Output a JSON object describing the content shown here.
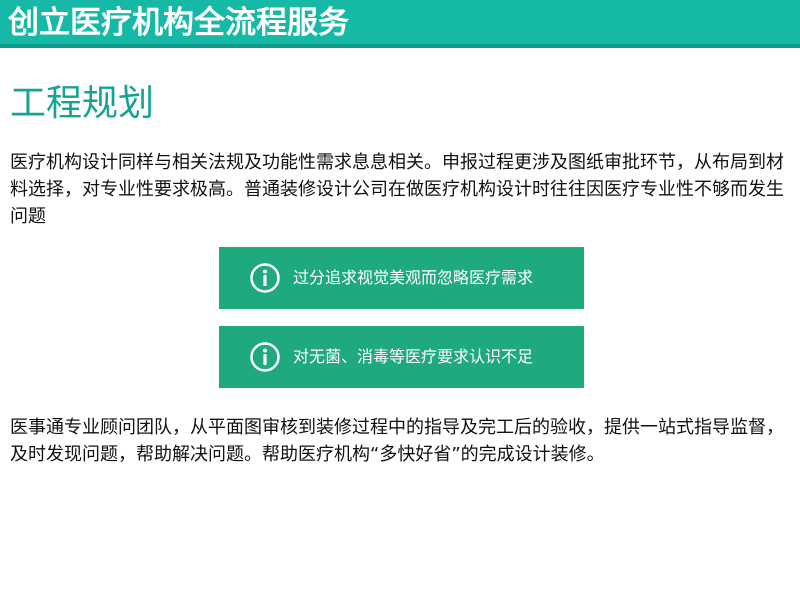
{
  "header": {
    "title": "创立医疗机构全流程服务"
  },
  "section": {
    "title": "工程规划"
  },
  "intro": {
    "text": "医疗机构设计同样与相关法规及功能性需求息息相关。申报过程更涉及图纸审批环节，从布局到材料选择，对专业性要求极高。普通装修设计公司在做医疗机构设计时往往因医疗专业性不够而发生问题"
  },
  "notices": [
    {
      "icon": "info-icon",
      "text": "过分追求视觉美观而忽略医疗需求"
    },
    {
      "icon": "info-icon",
      "text": "对无菌、消毒等医疗要求认识不足"
    }
  ],
  "summary": {
    "text": "医事通专业顾问团队，从平面图审核到装修过程中的指导及完工后的验收，提供一站式指导监督，及时发现问题，帮助解决问题。帮助医疗机构“多快好省”的完成设计装修。"
  },
  "colors": {
    "header_bg": "#16b8a6",
    "title_accent": "#16a394",
    "notice_bg": "#1fa97f"
  }
}
